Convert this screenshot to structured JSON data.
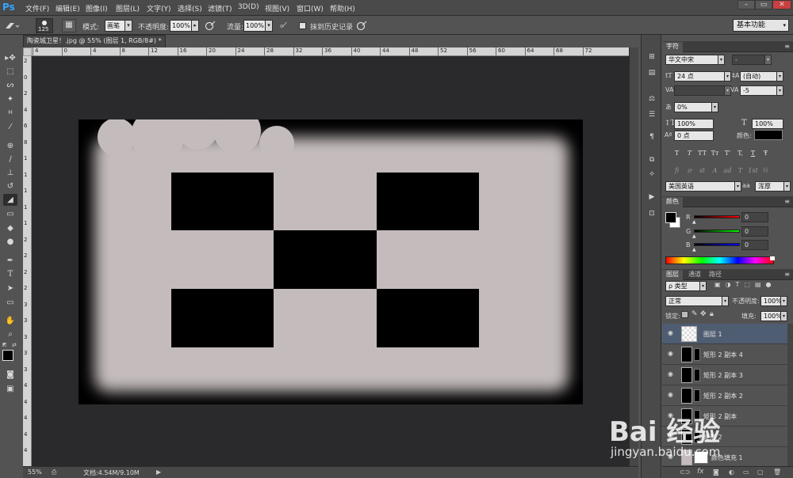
{
  "app": {
    "logo": "Ps"
  },
  "menu": [
    "文件(F)",
    "编辑(E)",
    "图像(I)",
    "图层(L)",
    "文字(Y)",
    "选择(S)",
    "滤镜(T)",
    "3D(D)",
    "视图(V)",
    "窗口(W)",
    "帮助(H)"
  ],
  "window_controls": {
    "minimize": "–",
    "restore": "▭",
    "close": "✕"
  },
  "options": {
    "brush_size": "125",
    "mode_label": "模式:",
    "mode_value": "画笔",
    "opacity_label": "不透明度:",
    "opacity_value": "100%",
    "flow_label": "流量:",
    "flow_value": "100%",
    "history_label": "抹到历史记录",
    "workspace": "基本功能"
  },
  "document": {
    "tab_title": "陶瓷城卫星！.jpg @ 55% (图层 1, RGB/8#) *",
    "zoom": "55%",
    "doc_info": "文档:4.54M/9.10M",
    "ruler_h": [
      "4",
      "0",
      "4",
      "8",
      "12",
      "16",
      "20",
      "24",
      "28",
      "32",
      "36",
      "40",
      "44",
      "48",
      "52",
      "56",
      "60",
      "64",
      "68",
      "72"
    ],
    "ruler_v": [
      "2",
      "0",
      "2",
      "4",
      "6",
      "8",
      "1",
      "1",
      "1",
      "1",
      "1",
      "2",
      "2",
      "2",
      "2",
      "3",
      "3",
      "3",
      "3",
      "3",
      "4",
      "4",
      "4",
      "4",
      "4"
    ]
  },
  "canvas_colors": {
    "fill": "#c4bcbc",
    "shape": "#000000",
    "background": "#000000"
  },
  "character_panel": {
    "tab": "字符",
    "font_family": "华文中宋",
    "font_style": "-",
    "font_size": "24 点",
    "leading": "(自动)",
    "kerning": "",
    "tracking": "-5",
    "scale_pct": "0%",
    "vscale": "100%",
    "hscale": "100%",
    "baseline": "0 点",
    "color_label": "颜色:",
    "language": "美国英语",
    "aa_label": "aa",
    "antialias": "浑厚",
    "style_buttons": [
      "T",
      "T",
      "TT",
      "Tт",
      "T'",
      "T,",
      "T",
      "Ŧ"
    ],
    "ot_buttons": [
      "fi",
      "ơ",
      "st",
      "A",
      "ad",
      "T",
      "1st",
      "½"
    ]
  },
  "color_panel": {
    "tab": "颜色",
    "r_label": "R",
    "r_value": "0",
    "g_label": "G",
    "g_value": "0",
    "b_label": "B",
    "b_value": "0"
  },
  "layers_panel": {
    "tabs": [
      "图层",
      "通道",
      "路径"
    ],
    "filter_kind": "ρ 类型",
    "blend_mode": "正常",
    "opacity_label": "不透明度:",
    "opacity_value": "100%",
    "lock_label": "锁定:",
    "fill_label": "填充:",
    "fill_value": "100%",
    "layers": [
      {
        "name": "图层 1",
        "selected": true
      },
      {
        "name": "矩形 2 副本 4",
        "selected": false
      },
      {
        "name": "矩形 2 副本 3",
        "selected": false
      },
      {
        "name": "矩形 2 副本 2",
        "selected": false
      },
      {
        "name": "矩形 2 副本",
        "selected": false
      },
      {
        "name": "矩形 2",
        "selected": false
      },
      {
        "name": "颜色填充 1",
        "selected": false
      }
    ]
  },
  "watermark": {
    "logo": "Bai 经验",
    "url": "jingyan.baidu.com"
  }
}
